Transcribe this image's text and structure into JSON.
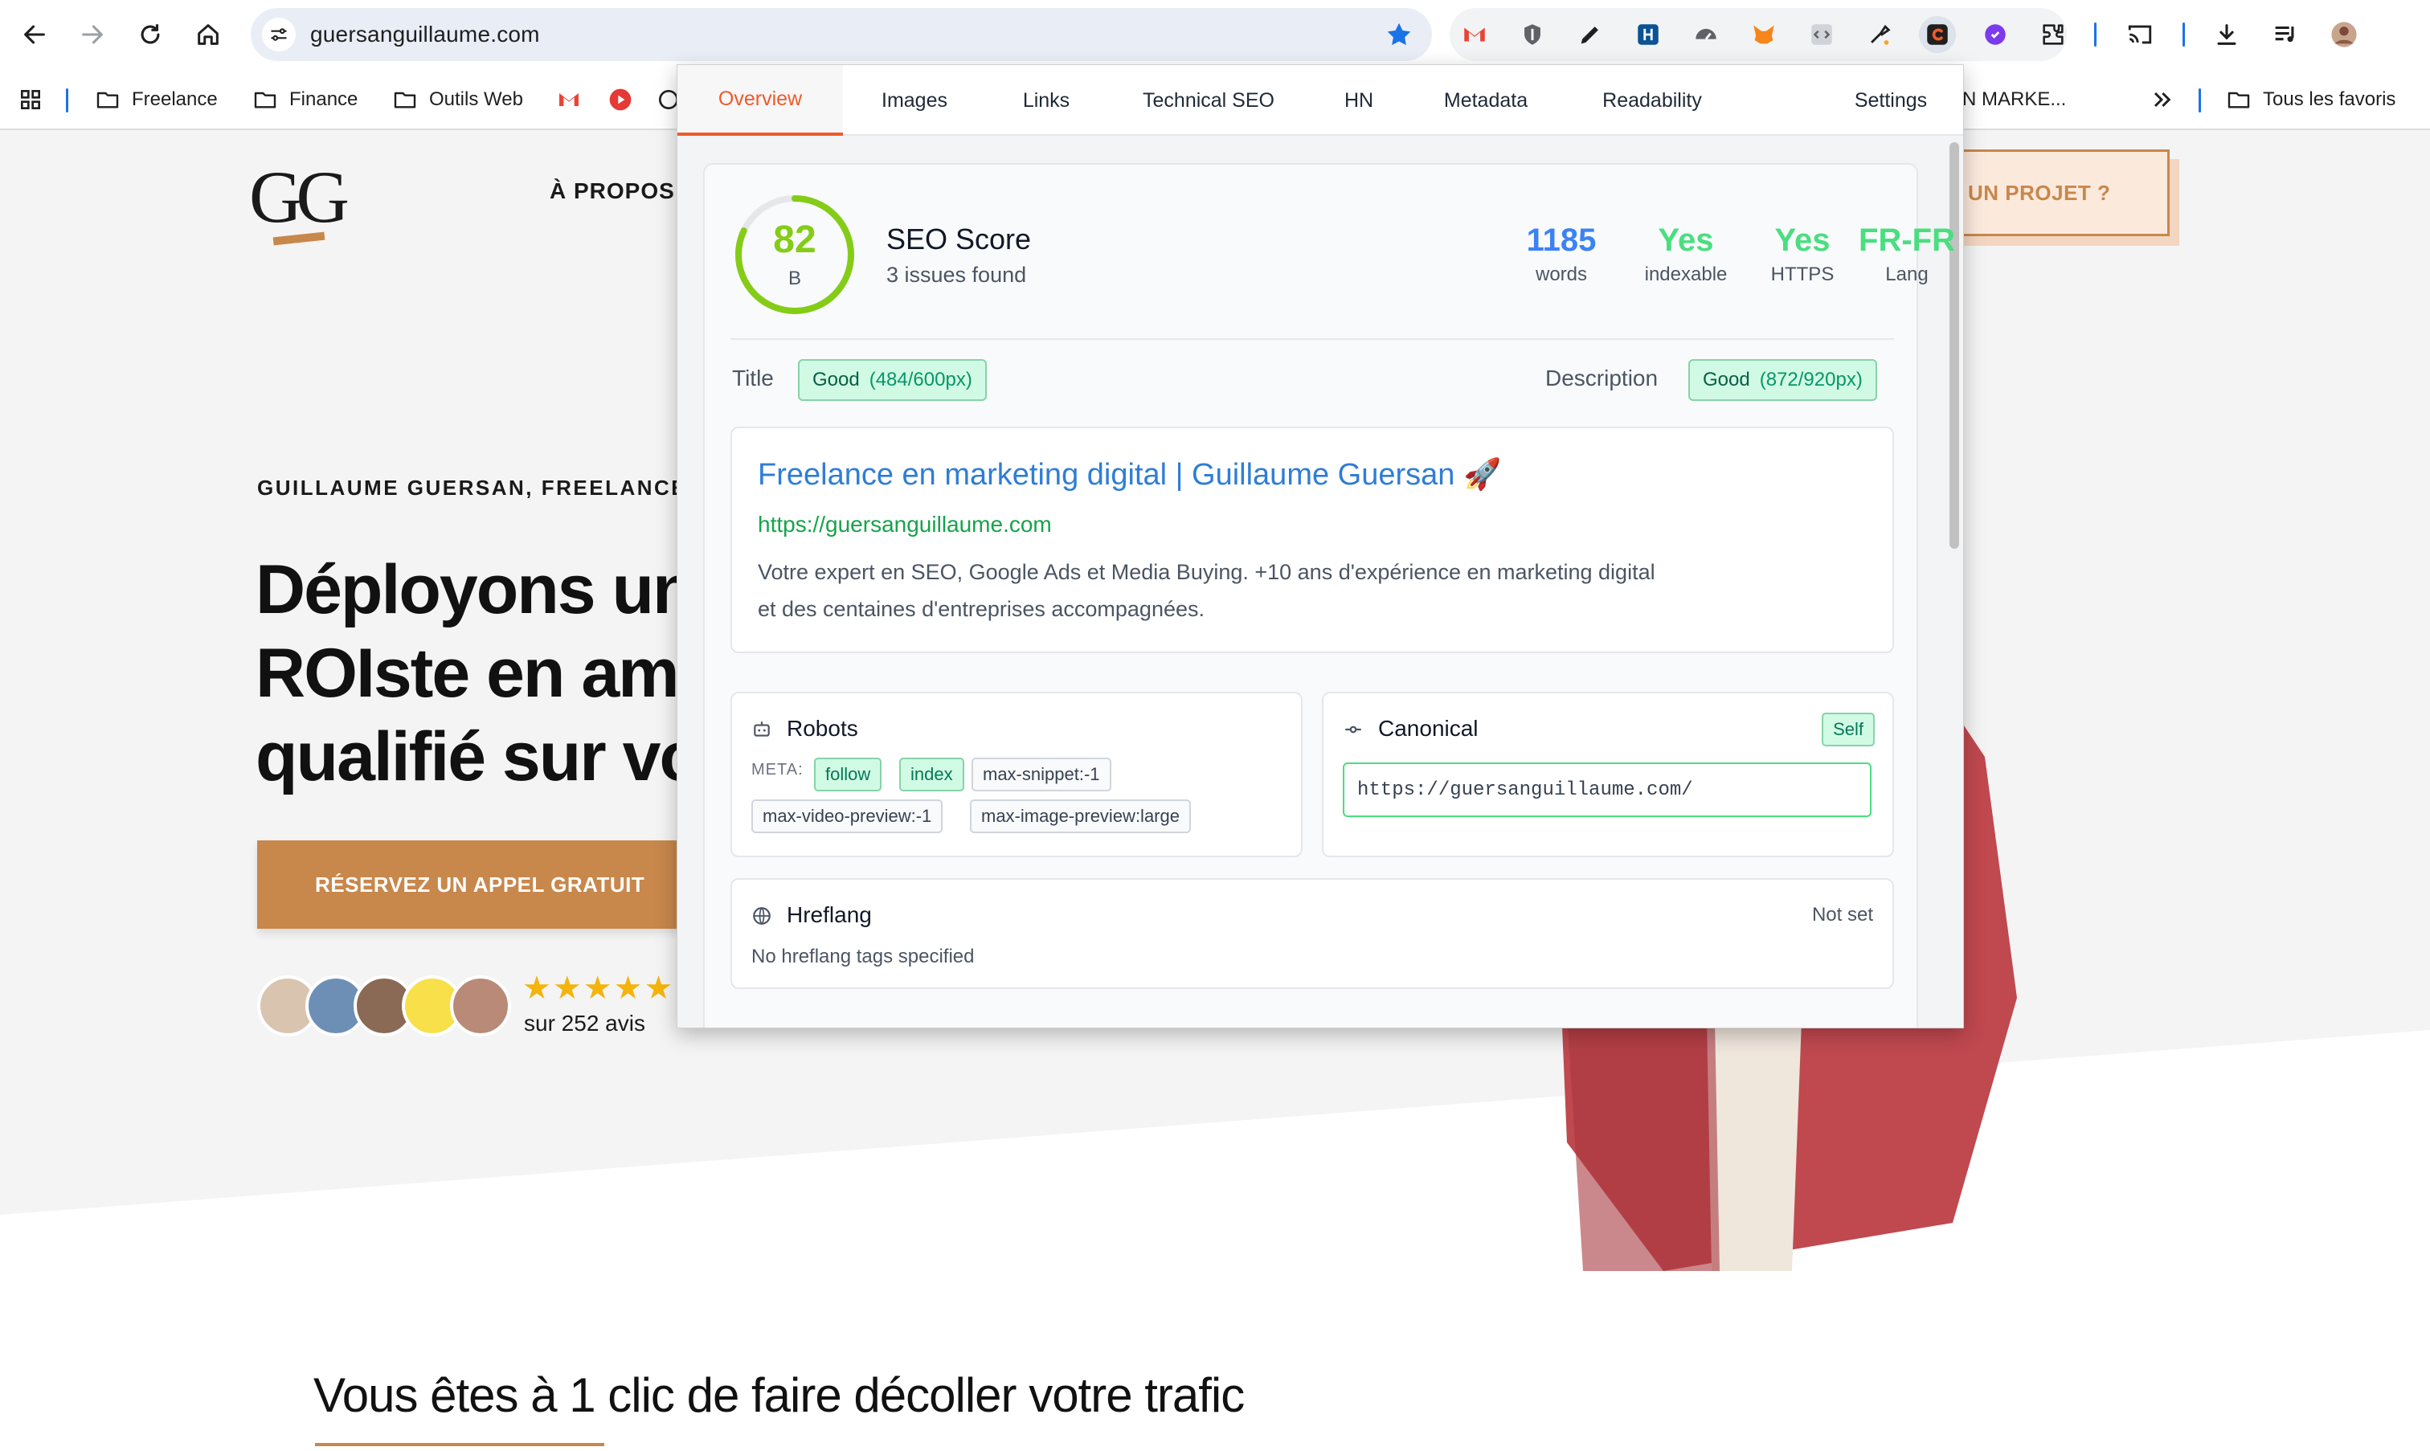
{
  "browser": {
    "url": "guersanguillaume.com",
    "bookmarks": [
      {
        "label": "Freelance"
      },
      {
        "label": "Finance"
      },
      {
        "label": "Outils Web"
      },
      {
        "label": "N MARKE..."
      },
      {
        "label": "Tous les favoris"
      }
    ],
    "accent": "#1a73e8"
  },
  "site": {
    "nav_link": "À PROPOS",
    "cta_right": "UN PROJET ?",
    "eyebrow": "GUILLAUME GUERSAN, FREELANCE E",
    "hero_lines": [
      "Déployons un",
      "ROIste en ame",
      "qualifié sur vo"
    ],
    "hero_cta": "RÉSERVEZ UN APPEL GRATUIT",
    "stars": "★★★★★",
    "reviews": "sur 252 avis",
    "section_title": "Vous êtes à 1 clic de faire décoller votre trafic",
    "accent": "#c8874b"
  },
  "popup": {
    "tabs": [
      "Overview",
      "Images",
      "Links",
      "Technical SEO",
      "HN",
      "Metadata",
      "Readability",
      "Settings"
    ],
    "active_tab": "Overview",
    "score": {
      "value": "82",
      "fraction": 0.82,
      "grade": "B",
      "title": "SEO Score",
      "subtitle": "3 issues found"
    },
    "stats": [
      {
        "value": "1185",
        "label": "words",
        "color": "#3b82f6"
      },
      {
        "value": "Yes",
        "label": "indexable",
        "color": "#4ade80"
      },
      {
        "value": "Yes",
        "label": "HTTPS",
        "color": "#4ade80"
      },
      {
        "value": "FR-FR",
        "label": "Lang",
        "color": "#4ade80"
      }
    ],
    "title_field": {
      "label": "Title",
      "status": "Good",
      "detail": "(484/600px)"
    },
    "description_field": {
      "label": "Description",
      "status": "Good",
      "detail": "(872/920px)"
    },
    "serp": {
      "title": "Freelance en marketing digital | Guillaume Guersan 🚀",
      "url": "https://guersanguillaume.com",
      "desc_line1": "Votre expert en SEO, Google Ads et Media Buying. +10 ans d'expérience en marketing digital",
      "desc_line2": "et des centaines d'entreprises accompagnées."
    },
    "robots": {
      "title": "Robots",
      "meta_label": "META:",
      "chips": [
        "follow",
        "index",
        "max-snippet:-1",
        "max-video-preview:-1",
        "max-image-preview:large"
      ]
    },
    "canonical": {
      "title": "Canonical",
      "badge": "Self",
      "value": "https://guersanguillaume.com/"
    },
    "hreflang": {
      "title": "Hreflang",
      "status": "Not set",
      "message": "No hreflang tags specified"
    }
  }
}
